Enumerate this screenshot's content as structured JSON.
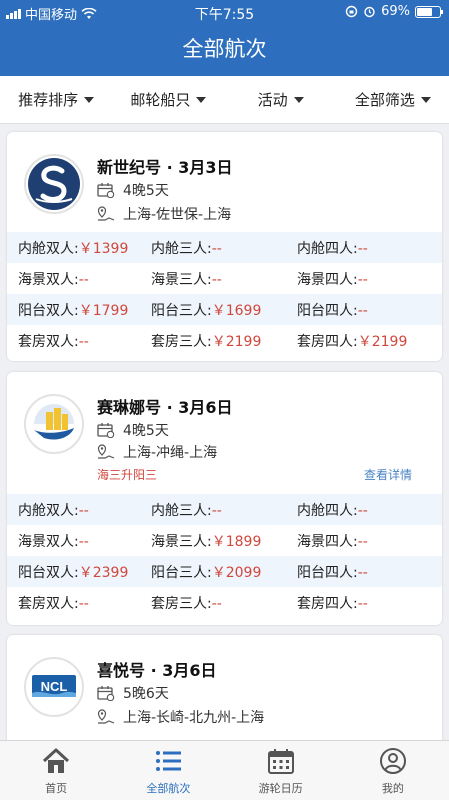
{
  "status": {
    "carrier": "中国移动",
    "time": "下午7:55",
    "battery": "69%",
    "battery_level": 0.69
  },
  "header": {
    "title": "全部航次"
  },
  "filters": [
    {
      "label": "推荐排序"
    },
    {
      "label": "邮轮船只"
    },
    {
      "label": "活动"
    },
    {
      "label": "全部筛选"
    }
  ],
  "cruises": [
    {
      "ship": "新世纪号 · 3月3日",
      "duration": "4晚5天",
      "route": "上海-佐世保-上海",
      "promo": "",
      "detail": "",
      "logo": "celestyal-logo",
      "prices": [
        [
          {
            "label": "内舱双人:",
            "value": "￥1399"
          },
          {
            "label": "内舱三人:",
            "value": "--"
          },
          {
            "label": "内舱四人:",
            "value": "--"
          }
        ],
        [
          {
            "label": "海景双人:",
            "value": "--"
          },
          {
            "label": "海景三人:",
            "value": "--"
          },
          {
            "label": "海景四人:",
            "value": "--"
          }
        ],
        [
          {
            "label": "阳台双人:",
            "value": "￥1799"
          },
          {
            "label": "阳台三人:",
            "value": "￥1699"
          },
          {
            "label": "阳台四人:",
            "value": "--"
          }
        ],
        [
          {
            "label": "套房双人:",
            "value": "--"
          },
          {
            "label": "套房三人:",
            "value": "￥2199"
          },
          {
            "label": "套房四人:",
            "value": "￥2199"
          }
        ]
      ]
    },
    {
      "ship": "赛琳娜号 · 3月6日",
      "duration": "4晚5天",
      "route": "上海-冲绳-上海",
      "promo": "海三升阳三",
      "detail": "查看详情",
      "logo": "costa-logo",
      "prices": [
        [
          {
            "label": "内舱双人:",
            "value": "--"
          },
          {
            "label": "内舱三人:",
            "value": "--"
          },
          {
            "label": "内舱四人:",
            "value": "--"
          }
        ],
        [
          {
            "label": "海景双人:",
            "value": "--"
          },
          {
            "label": "海景三人:",
            "value": "￥1899"
          },
          {
            "label": "海景四人:",
            "value": "--"
          }
        ],
        [
          {
            "label": "阳台双人:",
            "value": "￥2399"
          },
          {
            "label": "阳台三人:",
            "value": "￥2099"
          },
          {
            "label": "阳台四人:",
            "value": "--"
          }
        ],
        [
          {
            "label": "套房双人:",
            "value": "--"
          },
          {
            "label": "套房三人:",
            "value": "--"
          },
          {
            "label": "套房四人:",
            "value": "--"
          }
        ]
      ]
    },
    {
      "ship": "喜悦号 · 3月6日",
      "duration": "5晚6天",
      "route": "上海-长崎-北九州-上海",
      "promo": "",
      "detail": "",
      "logo": "ncl-logo",
      "logo_text": "NCL",
      "prices": []
    }
  ],
  "tabs": [
    {
      "label": "首页",
      "icon": "home-icon",
      "active": false
    },
    {
      "label": "全部航次",
      "icon": "list-icon",
      "active": true
    },
    {
      "label": "游轮日历",
      "icon": "calendar-icon",
      "active": false
    },
    {
      "label": "我的",
      "icon": "user-icon",
      "active": false
    }
  ],
  "colors": {
    "primary": "#2d6fbe",
    "price": "#d0473c",
    "link": "#4a83c4",
    "row_shade": "#eef5fc"
  }
}
